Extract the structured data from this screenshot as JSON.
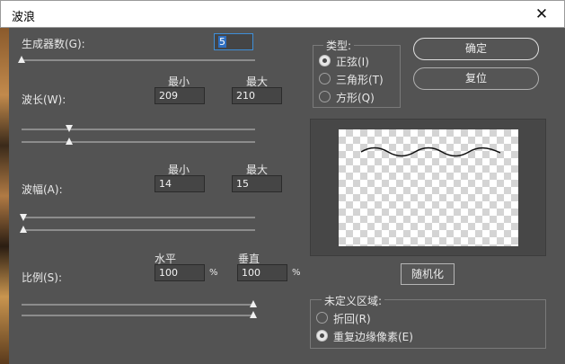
{
  "window": {
    "title": "波浪",
    "close_glyph": "✕"
  },
  "generators": {
    "label": "生成器数(G):",
    "value": "5"
  },
  "wavelength": {
    "label": "波长(W):",
    "min_label": "最小",
    "max_label": "最大",
    "min_value": "209",
    "max_value": "210"
  },
  "amplitude": {
    "label": "波幅(A):",
    "min_label": "最小",
    "max_label": "最大",
    "min_value": "14",
    "max_value": "15"
  },
  "scale": {
    "label": "比例(S):",
    "h_label": "水平",
    "v_label": "垂直",
    "h_value": "100",
    "v_value": "100",
    "unit": "%"
  },
  "type_group": {
    "title": "类型:",
    "options": [
      "正弦(I)",
      "三角形(T)",
      "方形(Q)"
    ],
    "selected": 0
  },
  "buttons": {
    "ok": "确定",
    "reset": "复位",
    "randomize": "随机化"
  },
  "undefined_area": {
    "title": "未定义区域:",
    "options": [
      "折回(R)",
      "重复边缘像素(E)"
    ],
    "selected": 1
  }
}
